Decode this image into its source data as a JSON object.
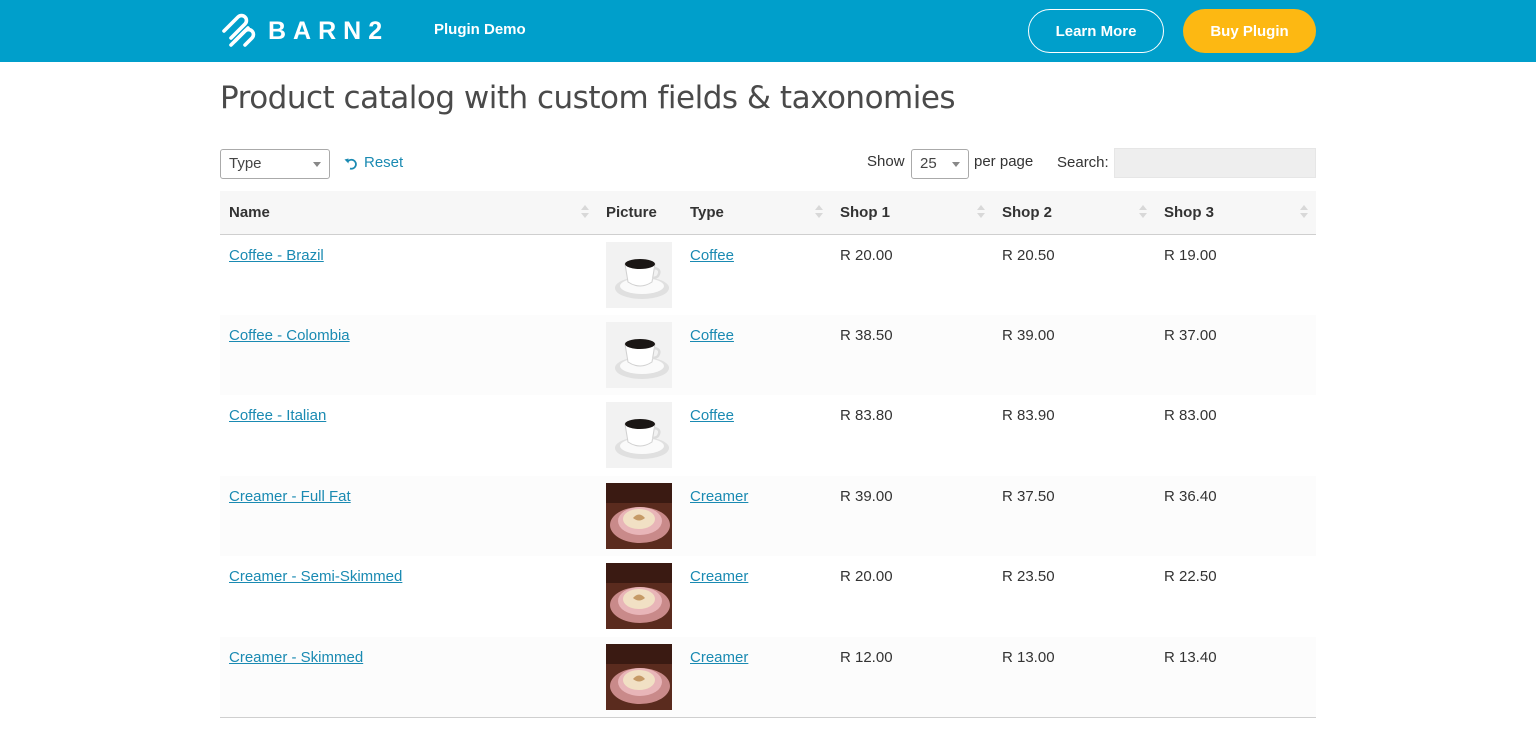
{
  "header": {
    "brand": "BARN2",
    "nav_label": "Plugin Demo",
    "learn_more": "Learn More",
    "buy_plugin": "Buy Plugin"
  },
  "page": {
    "title": "Product catalog with custom fields & taxonomies"
  },
  "controls": {
    "type_filter": "Type",
    "reset": "Reset",
    "show": "Show",
    "page_length": "25",
    "per_page": "per page",
    "search_label": "Search:",
    "search_value": ""
  },
  "table": {
    "columns": [
      "Name",
      "Picture",
      "Type",
      "Shop 1",
      "Shop 2",
      "Shop 3"
    ],
    "rows": [
      {
        "name": "Coffee - Brazil",
        "picture": "coffee-cup",
        "type": "Coffee",
        "shop1": "R 20.00",
        "shop2": "R 20.50",
        "shop3": "R 19.00"
      },
      {
        "name": "Coffee - Colombia",
        "picture": "coffee-cup",
        "type": "Coffee",
        "shop1": "R 38.50",
        "shop2": "R 39.00",
        "shop3": "R 37.00"
      },
      {
        "name": "Coffee - Italian",
        "picture": "coffee-cup",
        "type": "Coffee",
        "shop1": "R 83.80",
        "shop2": "R 83.90",
        "shop3": "R 83.00"
      },
      {
        "name": "Creamer - Full Fat",
        "picture": "latte-cup",
        "type": "Creamer",
        "shop1": "R 39.00",
        "shop2": "R 37.50",
        "shop3": "R 36.40"
      },
      {
        "name": "Creamer - Semi-Skimmed",
        "picture": "latte-cup",
        "type": "Creamer",
        "shop1": "R 20.00",
        "shop2": "R 23.50",
        "shop3": "R 22.50"
      },
      {
        "name": "Creamer - Skimmed",
        "picture": "latte-cup",
        "type": "Creamer",
        "shop1": "R 12.00",
        "shop2": "R 13.00",
        "shop3": "R 13.40"
      }
    ]
  },
  "colors": {
    "header_bg": "#009fcb",
    "buy_button": "#fdb812",
    "link": "#1a8ab2"
  }
}
